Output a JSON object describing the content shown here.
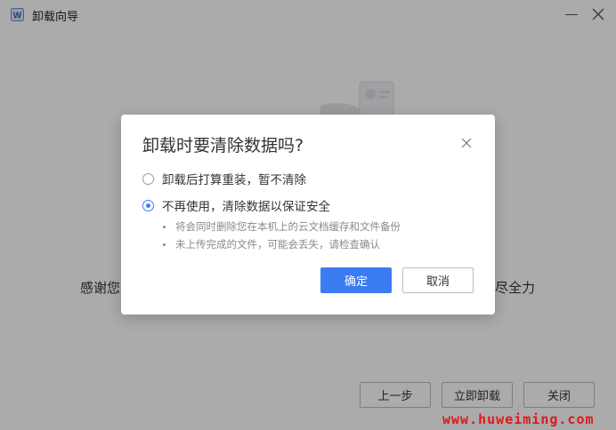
{
  "window": {
    "title": "卸载向导",
    "minimize_icon": "minimize-icon",
    "close_icon": "close-icon"
  },
  "background": {
    "thanks_left": "感谢您",
    "thanks_right": "尽全力",
    "buttons": {
      "prev": "上一步",
      "uninstall_now": "立即卸载",
      "close": "关闭"
    }
  },
  "dialog": {
    "title": "卸载时要清除数据吗?",
    "options": [
      {
        "label": "卸载后打算重装，暂不清除",
        "selected": false
      },
      {
        "label": "不再使用，清除数据以保证安全",
        "selected": true
      }
    ],
    "notes": [
      "将会同时删除您在本机上的云文档缓存和文件备份",
      "未上传完成的文件，可能会丢失，请检查确认"
    ],
    "confirm_label": "确定",
    "cancel_label": "取消"
  },
  "watermark": "www.huweiming.com",
  "colors": {
    "accent": "#3c7cf3",
    "watermark": "#e0181b"
  }
}
